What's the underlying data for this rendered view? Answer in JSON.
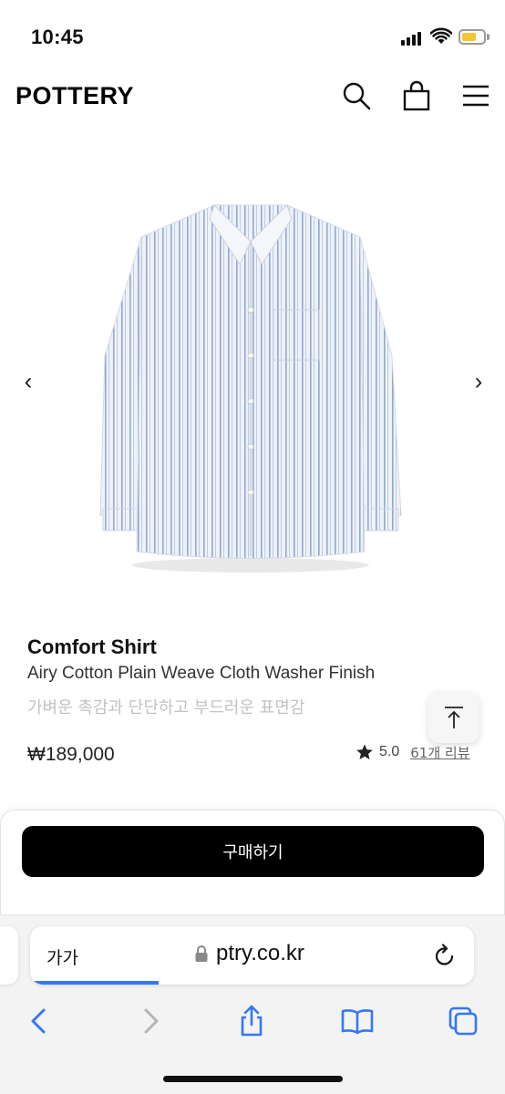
{
  "status_bar": {
    "time": "10:45"
  },
  "header": {
    "logo": "POTTERY"
  },
  "gallery": {
    "prev": "‹",
    "next": "›"
  },
  "product": {
    "name": "Comfort Shirt",
    "description": "Airy Cotton Plain Weave Cloth Washer Finish",
    "subtitle": "가벼운 촉감과 단단하고 부드러운 표면감",
    "price": "₩189,000",
    "rating": "5.0",
    "reviews": "61개 리뷰"
  },
  "buy_button": {
    "label": "구매하기"
  },
  "browser": {
    "aa_label": "가가",
    "url": "ptry.co.kr",
    "load_progress": 0.29
  },
  "colors": {
    "accent": "#3478f6",
    "battery": "#f3c531",
    "buy_bg": "#000000"
  }
}
